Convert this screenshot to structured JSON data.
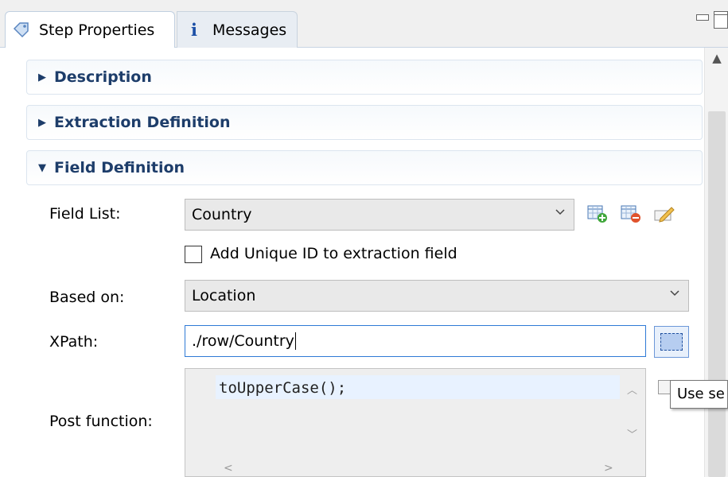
{
  "tabs": [
    {
      "label": "Step Properties",
      "icon": "tag-icon",
      "active": true
    },
    {
      "label": "Messages",
      "icon": "info-icon",
      "active": false
    }
  ],
  "view_buttons": [
    "minimize-icon",
    "maximize-icon"
  ],
  "sections": {
    "description": {
      "label": "Description",
      "expanded": false
    },
    "extraction_definition": {
      "label": "Extraction Definition",
      "expanded": false
    },
    "field_definition": {
      "label": "Field Definition",
      "expanded": true
    }
  },
  "field_list": {
    "label": "Field List:",
    "value": "Country",
    "icons": [
      "add-field-icon",
      "remove-field-icon",
      "rename-field-icon"
    ]
  },
  "unique_id": {
    "label": "Add Unique ID to extraction field",
    "checked": false
  },
  "based_on": {
    "label": "Based on:",
    "value": "Location"
  },
  "xpath": {
    "label": "XPath:",
    "value": "./row/Country",
    "select_button_icon": "element-selector-icon"
  },
  "post_function": {
    "label": "Post function:",
    "code": "toUpperCase();"
  },
  "tooltip": {
    "text": "Use se"
  },
  "colors": {
    "section_header_text": "#1d3d6a",
    "focus_border": "#2e7ad6",
    "info_icon": "#1b4fa6"
  }
}
